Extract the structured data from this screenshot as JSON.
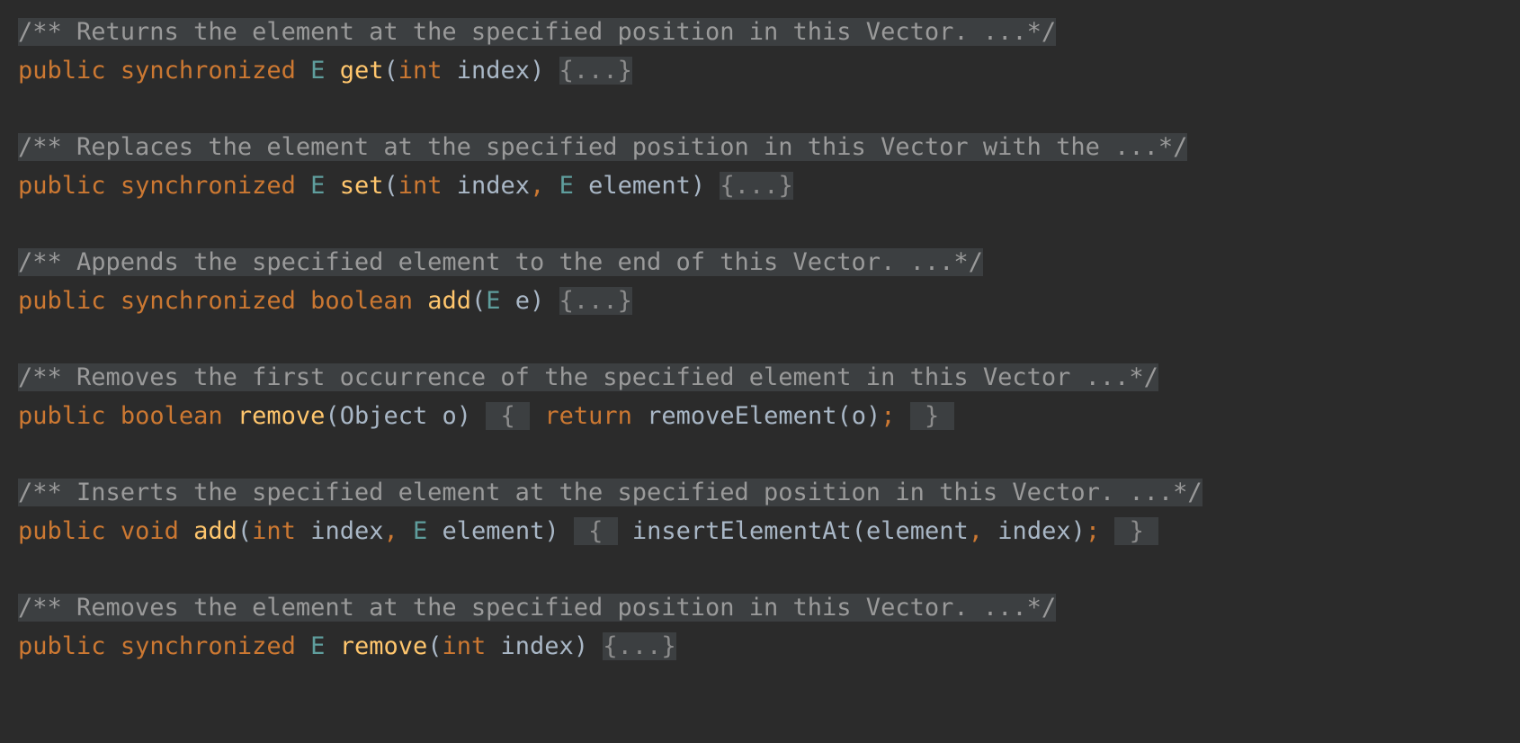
{
  "editor": {
    "language": "java",
    "theme": "darcula",
    "background_color": "#2b2b2b",
    "fold_background_color": "#3c3f41",
    "colors": {
      "keyword": "#cc7832",
      "type": "#5f9e9d",
      "method_name": "#ffc66d",
      "identifier": "#a9b7c6",
      "comment": "#9a9a9a",
      "folded_text": "#8c8c8c"
    },
    "lines": [
      {
        "kind": "comment",
        "folded": true,
        "text": "/** Returns the element at the specified position in this Vector. ...*/"
      },
      {
        "kind": "code",
        "tokens": [
          {
            "t": "public",
            "c": "kw"
          },
          {
            "t": " ",
            "c": "plain"
          },
          {
            "t": "synchronized",
            "c": "kw"
          },
          {
            "t": " ",
            "c": "plain"
          },
          {
            "t": "E",
            "c": "type"
          },
          {
            "t": " ",
            "c": "plain"
          },
          {
            "t": "get",
            "c": "method"
          },
          {
            "t": "(",
            "c": "plain"
          },
          {
            "t": "int",
            "c": "kw"
          },
          {
            "t": " index",
            "c": "plain"
          },
          {
            "t": ")",
            "c": "plain"
          },
          {
            "t": " ",
            "c": "plain"
          },
          {
            "t": "{...}",
            "c": "fold-body"
          }
        ]
      },
      {
        "kind": "blank"
      },
      {
        "kind": "comment",
        "folded": true,
        "text": "/** Replaces the element at the specified position in this Vector with the ...*/"
      },
      {
        "kind": "code",
        "tokens": [
          {
            "t": "public",
            "c": "kw"
          },
          {
            "t": " ",
            "c": "plain"
          },
          {
            "t": "synchronized",
            "c": "kw"
          },
          {
            "t": " ",
            "c": "plain"
          },
          {
            "t": "E",
            "c": "type"
          },
          {
            "t": " ",
            "c": "plain"
          },
          {
            "t": "set",
            "c": "method"
          },
          {
            "t": "(",
            "c": "plain"
          },
          {
            "t": "int",
            "c": "kw"
          },
          {
            "t": " index",
            "c": "plain"
          },
          {
            "t": ",",
            "c": "punct-kw"
          },
          {
            "t": " ",
            "c": "plain"
          },
          {
            "t": "E",
            "c": "type"
          },
          {
            "t": " element",
            "c": "plain"
          },
          {
            "t": ")",
            "c": "plain"
          },
          {
            "t": " ",
            "c": "plain"
          },
          {
            "t": "{...}",
            "c": "fold-body"
          }
        ]
      },
      {
        "kind": "blank"
      },
      {
        "kind": "comment",
        "folded": true,
        "text": "/** Appends the specified element to the end of this Vector. ...*/"
      },
      {
        "kind": "code",
        "tokens": [
          {
            "t": "public",
            "c": "kw"
          },
          {
            "t": " ",
            "c": "plain"
          },
          {
            "t": "synchronized",
            "c": "kw"
          },
          {
            "t": " ",
            "c": "plain"
          },
          {
            "t": "boolean",
            "c": "kw"
          },
          {
            "t": " ",
            "c": "plain"
          },
          {
            "t": "add",
            "c": "method"
          },
          {
            "t": "(",
            "c": "plain"
          },
          {
            "t": "E",
            "c": "type"
          },
          {
            "t": " e",
            "c": "plain"
          },
          {
            "t": ")",
            "c": "plain"
          },
          {
            "t": " ",
            "c": "plain"
          },
          {
            "t": "{...}",
            "c": "fold-body"
          }
        ]
      },
      {
        "kind": "blank"
      },
      {
        "kind": "comment",
        "folded": true,
        "text": "/** Removes the first occurrence of the specified element in this Vector ...*/"
      },
      {
        "kind": "code",
        "tokens": [
          {
            "t": "public",
            "c": "kw"
          },
          {
            "t": " ",
            "c": "plain"
          },
          {
            "t": "boolean",
            "c": "kw"
          },
          {
            "t": " ",
            "c": "plain"
          },
          {
            "t": "remove",
            "c": "method"
          },
          {
            "t": "(",
            "c": "plain"
          },
          {
            "t": "Object",
            "c": "plain"
          },
          {
            "t": " o",
            "c": "plain"
          },
          {
            "t": ")",
            "c": "plain"
          },
          {
            "t": " ",
            "c": "plain"
          },
          {
            "t": " { ",
            "c": "fold-brace"
          },
          {
            "t": " ",
            "c": "plain"
          },
          {
            "t": "return",
            "c": "kw"
          },
          {
            "t": " removeElement(o)",
            "c": "plain"
          },
          {
            "t": ";",
            "c": "punct-kw"
          },
          {
            "t": " ",
            "c": "plain"
          },
          {
            "t": " } ",
            "c": "fold-brace"
          }
        ]
      },
      {
        "kind": "blank"
      },
      {
        "kind": "comment",
        "folded": true,
        "text": "/** Inserts the specified element at the specified position in this Vector. ...*/"
      },
      {
        "kind": "code",
        "tokens": [
          {
            "t": "public",
            "c": "kw"
          },
          {
            "t": " ",
            "c": "plain"
          },
          {
            "t": "void",
            "c": "kw"
          },
          {
            "t": " ",
            "c": "plain"
          },
          {
            "t": "add",
            "c": "method"
          },
          {
            "t": "(",
            "c": "plain"
          },
          {
            "t": "int",
            "c": "kw"
          },
          {
            "t": " index",
            "c": "plain"
          },
          {
            "t": ",",
            "c": "punct-kw"
          },
          {
            "t": " ",
            "c": "plain"
          },
          {
            "t": "E",
            "c": "type"
          },
          {
            "t": " element",
            "c": "plain"
          },
          {
            "t": ")",
            "c": "plain"
          },
          {
            "t": " ",
            "c": "plain"
          },
          {
            "t": " { ",
            "c": "fold-brace"
          },
          {
            "t": " insertElementAt(element",
            "c": "plain"
          },
          {
            "t": ",",
            "c": "punct-kw"
          },
          {
            "t": " index)",
            "c": "plain"
          },
          {
            "t": ";",
            "c": "punct-kw"
          },
          {
            "t": " ",
            "c": "plain"
          },
          {
            "t": " } ",
            "c": "fold-brace"
          }
        ]
      },
      {
        "kind": "blank"
      },
      {
        "kind": "comment",
        "folded": true,
        "text": "/** Removes the element at the specified position in this Vector. ...*/"
      },
      {
        "kind": "code",
        "tokens": [
          {
            "t": "public",
            "c": "kw"
          },
          {
            "t": " ",
            "c": "plain"
          },
          {
            "t": "synchronized",
            "c": "kw"
          },
          {
            "t": " ",
            "c": "plain"
          },
          {
            "t": "E",
            "c": "type"
          },
          {
            "t": " ",
            "c": "plain"
          },
          {
            "t": "remove",
            "c": "method"
          },
          {
            "t": "(",
            "c": "plain"
          },
          {
            "t": "int",
            "c": "kw"
          },
          {
            "t": " index",
            "c": "plain"
          },
          {
            "t": ")",
            "c": "plain"
          },
          {
            "t": " ",
            "c": "plain"
          },
          {
            "t": "{...}",
            "c": "fold-body"
          }
        ]
      }
    ]
  }
}
